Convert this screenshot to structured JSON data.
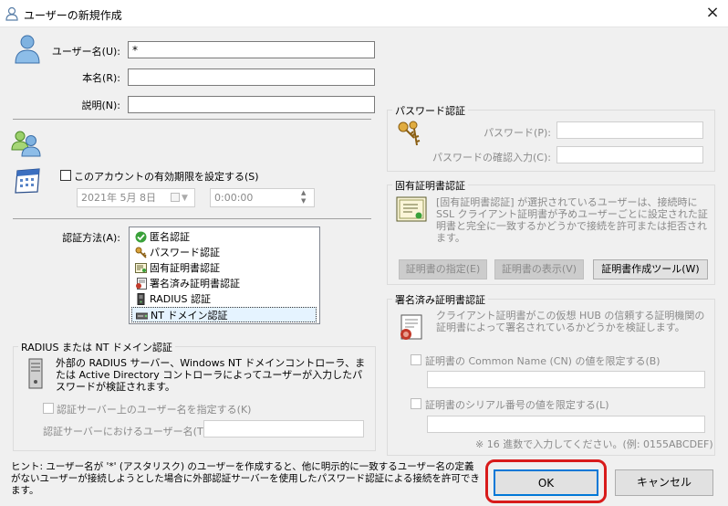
{
  "window": {
    "title": "ユーザーの新規作成",
    "close_glyph": "×"
  },
  "user": {
    "username_label": "ユーザー名(U):",
    "username_value": "*",
    "realname_label": "本名(R):",
    "realname_value": "",
    "note_label": "説明(N):",
    "note_value": ""
  },
  "expiry": {
    "checkbox_label": "このアカウントの有効期限を設定する(S)",
    "checked": false,
    "date_value": "2021年  5月  8日",
    "time_value": "0:00:00"
  },
  "auth": {
    "label": "認証方法(A):",
    "methods": [
      {
        "label": "匿名認証",
        "icon": "check-icon"
      },
      {
        "label": "パスワード認証",
        "icon": "key-icon"
      },
      {
        "label": "固有証明書認証",
        "icon": "certificate-icon"
      },
      {
        "label": "署名済み証明書認証",
        "icon": "signed-certificate-icon"
      },
      {
        "label": "RADIUS 認証",
        "icon": "server-icon"
      },
      {
        "label": "NT ドメイン認証",
        "icon": "domain-icon"
      }
    ],
    "selected": "NT ドメイン認証"
  },
  "radius": {
    "group_title": "RADIUS または NT ドメイン認証",
    "description": "外部の RADIUS サーバー、Windows NT ドメインコントローラ、または Active Directory コントローラによってユーザーが入力したパスワードが検証されます。",
    "specify_checkbox": "認証サーバー上のユーザー名を指定する(K)",
    "server_user_label": "認証サーバーにおけるユーザー名(T):",
    "server_user_value": ""
  },
  "password": {
    "group_title": "パスワード認証",
    "password_label": "パスワード(P):",
    "confirm_label": "パスワードの確認入力(C):"
  },
  "cert": {
    "group_title": "固有証明書認証",
    "description": "[固有証明書認証] が選択されているユーザーは、接続時に SSL クライアント証明書が予めユーザーごとに設定された証明書と完全に一致するかどうかで接続を許可または拒否されます。",
    "specify_button": "証明書の指定(E)",
    "view_button": "証明書の表示(V)",
    "tool_button": "証明書作成ツール(W)"
  },
  "signed": {
    "group_title": "署名済み証明書認証",
    "description": "クライアント証明書がこの仮想 HUB の信頼する証明機関の証明書によって署名されているかどうかを検証します。",
    "cn_checkbox": "証明書の Common Name (CN) の値を限定する(B)",
    "serial_checkbox": "証明書のシリアル番号の値を限定する(L)",
    "hex_note": "※ 16 進数で入力してください。(例: 0155ABCDEF)"
  },
  "hint": "ヒント: ユーザー名が '*' (アスタリスク) のユーザーを作成すると、他に明示的に一致するユーザー名の定義がないユーザーが接続しようとした場合に外部認証サーバーを使用したパスワード認証による接続を許可できます。",
  "buttons": {
    "ok": "OK",
    "cancel": "キャンセル"
  },
  "colors": {
    "highlight_ring": "#d81b1b",
    "selection": "#e5f3ff",
    "ok_border": "#0078d7"
  }
}
